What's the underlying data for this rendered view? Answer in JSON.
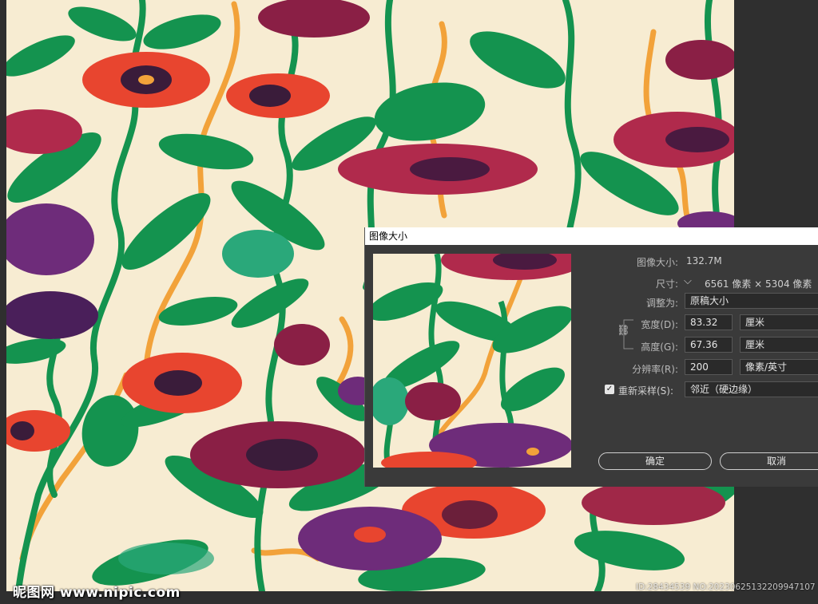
{
  "dialog": {
    "title": "图像大小",
    "image_size_label": "图像大小:",
    "image_size_value": "132.7M",
    "dimensions_label": "尺寸:",
    "dimensions_value": "6561 像素 × 5304 像素",
    "fit_to_label": "调整为:",
    "fit_to_value": "原稿大小",
    "width_label": "宽度(D):",
    "width_value": "83.32",
    "width_unit": "厘米",
    "height_label": "高度(G):",
    "height_value": "67.36",
    "height_unit": "厘米",
    "resolution_label": "分辨率(R):",
    "resolution_value": "200",
    "resolution_unit": "像素/英寸",
    "resample_label": "重新采样(S):",
    "resample_checked": true,
    "resample_value": "邻近（硬边缘）",
    "ok_label": "确定",
    "cancel_label": "取消"
  },
  "watermark": {
    "site": "昵图网 www.nipic.com",
    "id_text": "ID:28434539 NO:20230625132209947107"
  },
  "colors": {
    "background": "#f7ecd2",
    "leaf_green": "#14934f",
    "flower_red": "#e8452f",
    "flower_crimson": "#b02a4c",
    "flower_purple": "#6e2c7a",
    "stem_orange": "#f2a23a",
    "ui_dark": "#3a3a3a"
  }
}
